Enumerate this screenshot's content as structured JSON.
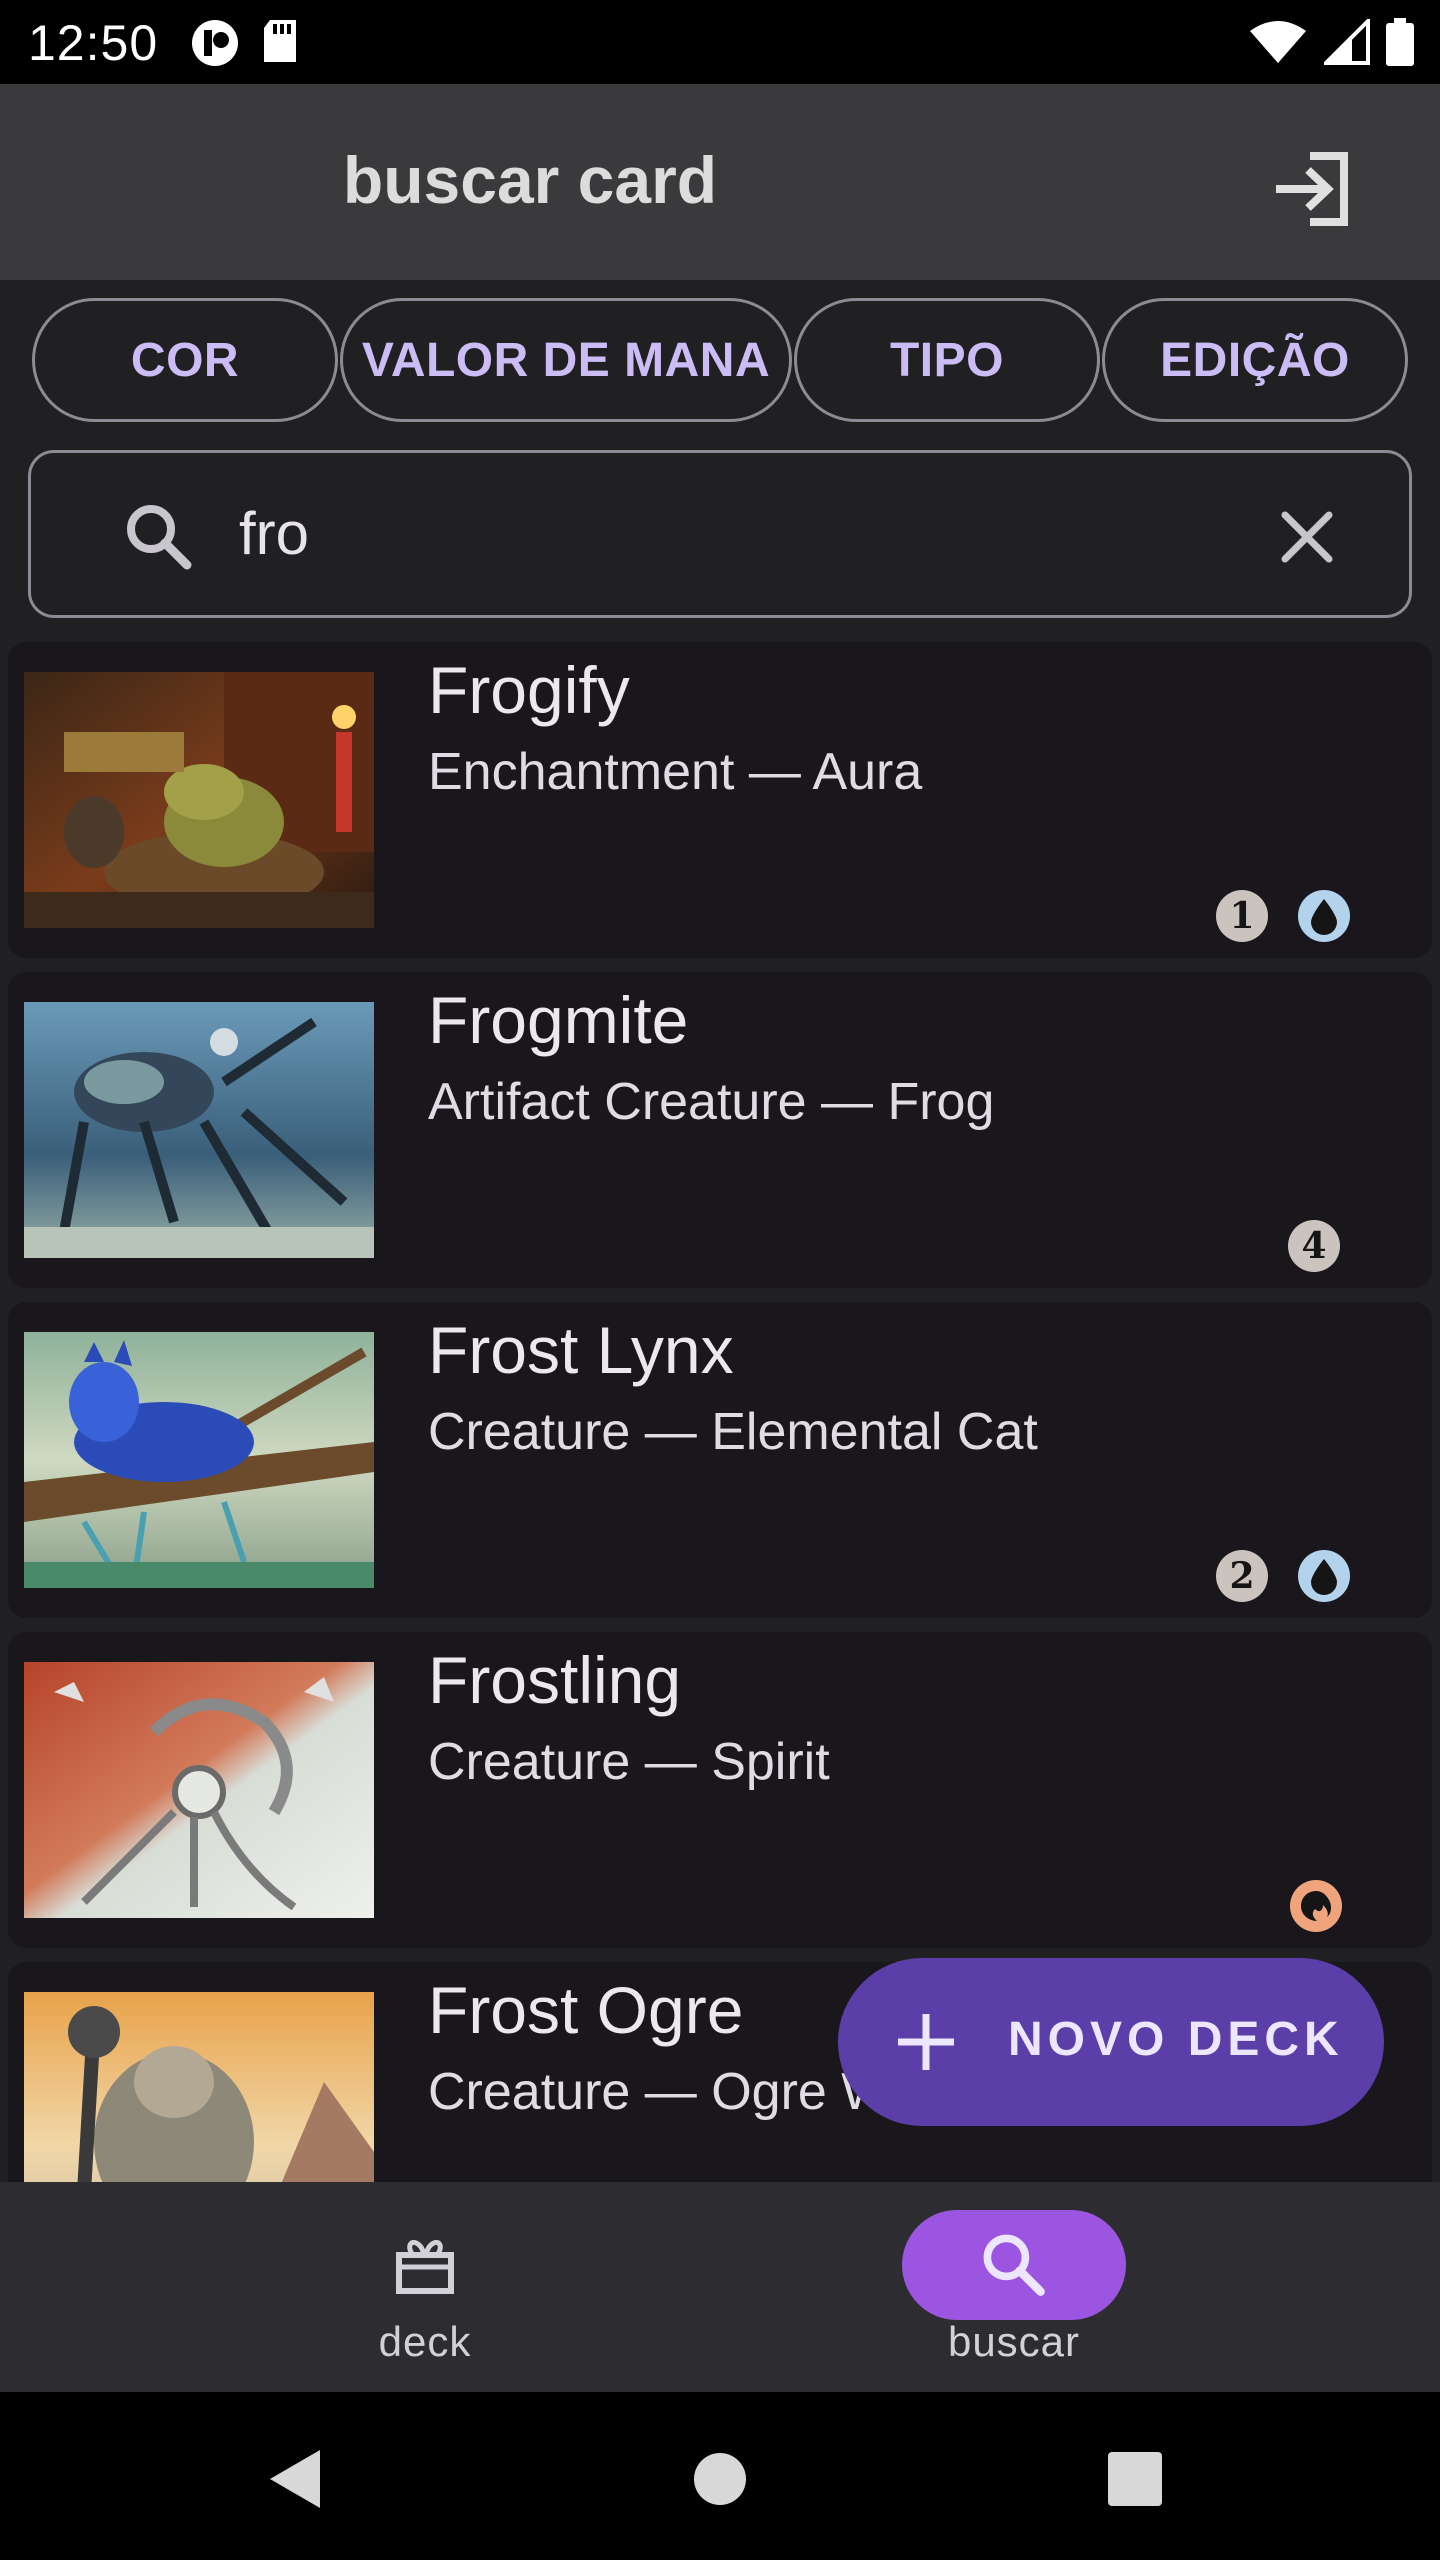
{
  "status_bar": {
    "time": "12:50"
  },
  "app_bar": {
    "title": "buscar card",
    "login_icon": "login-icon"
  },
  "filters": {
    "chips": [
      "COR",
      "VALOR DE MANA",
      "TIPO",
      "EDIÇÃO"
    ]
  },
  "search": {
    "value": "fro",
    "icon": "search-icon",
    "clear_icon": "close-icon"
  },
  "cards": [
    {
      "name": "Frogify",
      "type": "Enchantment — Aura",
      "mana": [
        {
          "kind": "generic",
          "text": "1"
        },
        {
          "kind": "blue",
          "text": ""
        }
      ]
    },
    {
      "name": "Frogmite",
      "type": "Artifact Creature — Frog",
      "mana": [
        {
          "kind": "generic",
          "text": "4"
        }
      ]
    },
    {
      "name": "Frost Lynx",
      "type": "Creature — Elemental Cat",
      "mana": [
        {
          "kind": "generic",
          "text": "2"
        },
        {
          "kind": "blue",
          "text": ""
        }
      ]
    },
    {
      "name": "Frostling",
      "type": "Creature — Spirit",
      "mana": [
        {
          "kind": "red",
          "text": ""
        }
      ]
    },
    {
      "name": "Frost Ogre",
      "type": "Creature — Ogre Warrior",
      "mana": []
    }
  ],
  "fab": {
    "label": "NOVO DECK",
    "icon": "plus-icon"
  },
  "bottom_nav": {
    "items": [
      {
        "label": "deck",
        "icon": "cards-icon",
        "active": false
      },
      {
        "label": "buscar",
        "icon": "search-icon",
        "active": true
      }
    ]
  },
  "colors": {
    "accent": "#9c55e0",
    "fab": "#5b3ea8",
    "chip_text": "#cbbcf5",
    "background": "#202022",
    "card_row": "#19171c",
    "app_bar": "#3a3a3d"
  }
}
